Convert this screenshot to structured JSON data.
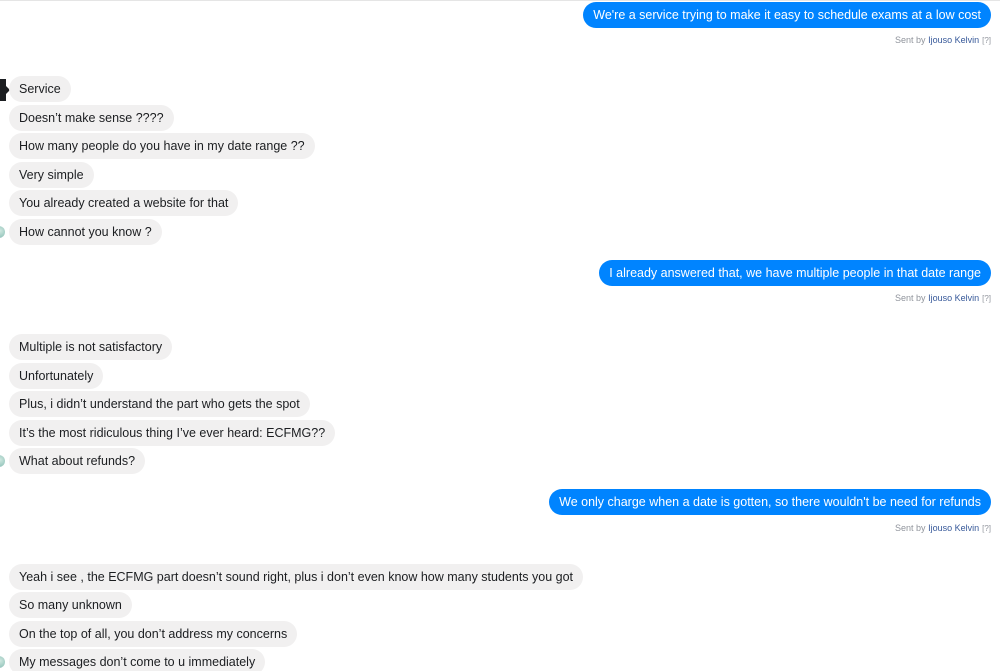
{
  "messages": {
    "out1": "We're a service trying to make it easy to schedule exams at a low cost",
    "out2": "I already answered that, we have multiple people in that date range",
    "out3": "We only charge when a date is gotten, so there wouldn't be need for refunds",
    "in": [
      "Service",
      "Doesn’t make sense ????",
      "How many people do you have in my date range ??",
      "Very simple",
      "You already created a website for that",
      "How cannot you know ?",
      "Multiple is not satisfactory",
      "Unfortunately",
      "Plus, i didn’t understand the part who gets the spot",
      "It’s the most ridiculous thing I’ve ever heard: ECFMG??",
      "What about refunds?",
      "Yeah i see , the ECFMG part doesn’t sound right, plus i don’t even know how many students you got",
      "So many unknown",
      "On the top of all, you don’t address my concerns",
      "My messages don’t come to u immediately"
    ]
  },
  "sent_by": {
    "prefix": "Sent by ",
    "name": "Ijouso Kelvin",
    "help": "[?]"
  }
}
